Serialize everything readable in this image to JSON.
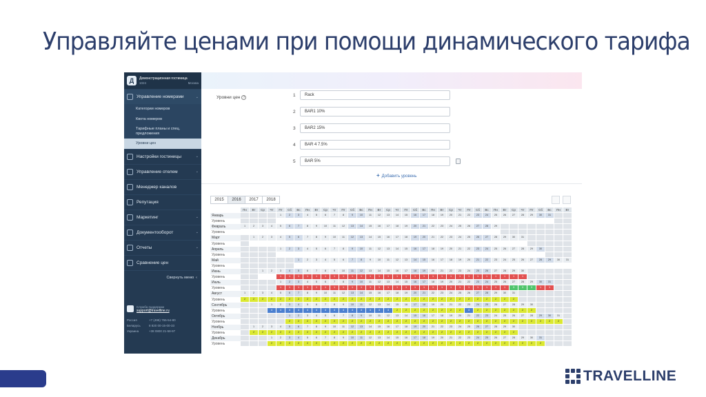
{
  "slide": {
    "title": "Управляйте ценами при помощи динамического тарифа",
    "brand": "TRAVELLINE"
  },
  "sidebar": {
    "hotel_initial": "Д",
    "hotel_name": "Демонстрационная гостиница",
    "hotel_id": "1024",
    "hotel_city": "Москва",
    "items": [
      {
        "label": "Управление номерами",
        "icon": "rooms-icon",
        "active": true
      },
      {
        "label": "Настройки гостиницы",
        "icon": "settings-icon"
      },
      {
        "label": "Управление отелем",
        "icon": "gear-icon"
      },
      {
        "label": "Менеджер каналов",
        "icon": "cog-icon"
      },
      {
        "label": "Репутация",
        "icon": "reputation-icon"
      },
      {
        "label": "Маркетинг",
        "icon": "mail-icon"
      },
      {
        "label": "Документооборот",
        "icon": "folder-icon"
      },
      {
        "label": "Отчеты",
        "icon": "chart-icon"
      },
      {
        "label": "Сравнение цен",
        "icon": "compare-icon"
      }
    ],
    "subitems": [
      "Категории номеров",
      "Квота номеров",
      "Тарифные планы и спец. предложения",
      "Уровни цен"
    ],
    "collapse_label": "Свернуть меню",
    "support_label": "Служба поддержки",
    "support_email": "support@travelline.ru",
    "phones": [
      {
        "country": "Россия",
        "number": "+7 (495) 755-54-80"
      },
      {
        "country": "Беларусь",
        "number": "8 820 00-15-00-33"
      },
      {
        "country": "Украина",
        "number": "+38 0800 21-58-97"
      }
    ]
  },
  "levels": {
    "label": "Уровни цен",
    "rows": [
      {
        "num": "1",
        "value": "Rack"
      },
      {
        "num": "2",
        "value": "BAR1 10%"
      },
      {
        "num": "3",
        "value": "BAR2 15%"
      },
      {
        "num": "4",
        "value": "BAR 4 7.5%"
      },
      {
        "num": "5",
        "value": "BAR 5%"
      }
    ],
    "add_label": "Добавить уровень"
  },
  "calendar": {
    "years": [
      "2015",
      "2016",
      "2017",
      "2018"
    ],
    "active_year": "2016",
    "weekdays": [
      "Пн",
      "Вт",
      "Ср",
      "Чт",
      "Пт",
      "Сб",
      "Вс",
      "Пн",
      "Вт",
      "Ср",
      "Чт",
      "Пт",
      "Сб",
      "Вс",
      "Пн",
      "Вт",
      "Ср",
      "Чт",
      "Пт",
      "Сб",
      "Вс",
      "Пн",
      "Вт",
      "Ср",
      "Чт",
      "Пт",
      "Сб",
      "Вс",
      "Пн",
      "Вт",
      "Ср",
      "Чт",
      "Пт",
      "Сб",
      "Вс",
      "Пн",
      "Вт"
    ],
    "level_label": "Уровень",
    "months": [
      {
        "name": "Январь",
        "offset": 4,
        "days": 31,
        "levels": ""
      },
      {
        "name": "Февраль",
        "offset": 0,
        "days": 29,
        "levels": ""
      },
      {
        "name": "Март",
        "offset": 1,
        "days": 31,
        "levels": ""
      },
      {
        "name": "Апрель",
        "offset": 4,
        "days": 30,
        "levels": ""
      },
      {
        "name": "Май",
        "offset": 6,
        "days": 31,
        "levels": ""
      },
      {
        "name": "Июнь",
        "offset": 2,
        "days": 30,
        "levels": "....RRRRRRRRRRRRRRRRRRRRRRRRRRRRRR"
      },
      {
        "name": "Июль",
        "offset": 4,
        "days": 31,
        "levels": "RRRRRRRRRRRRRRRRRRRRRRRRRRRRRRGGGRRR"
      },
      {
        "name": "Август",
        "offset": 0,
        "days": 31,
        "levels": "YYYYYYYYYYYYYYYYYYYYYYYYYYYYYYY"
      },
      {
        "name": "Сентябрь",
        "offset": 3,
        "days": 30,
        "levels": "...BBBBBBBBBBBBBBYYYYYYYYBYYYYYYY"
      },
      {
        "name": "Октябрь",
        "offset": 5,
        "days": 31,
        "levels": ".....YYYYYYYYYYYYYYYYYYYYYYYYYYYYYYY"
      },
      {
        "name": "Ноябрь",
        "offset": 1,
        "days": 30,
        "levels": ".YYYYYYYYYYYYYYYYYYYYYYYYYYYYYY"
      },
      {
        "name": "Декабрь",
        "offset": 3,
        "days": 31,
        "levels": "...YYYYYYYYYYYYYYYYYYYYYYYYYYYYYYY"
      }
    ]
  },
  "colors": {
    "red": "#e25050",
    "yellow": "#dbe831",
    "green": "#4fc46c",
    "blue": "#4a7fd0",
    "navy": "#2c3e6b"
  }
}
